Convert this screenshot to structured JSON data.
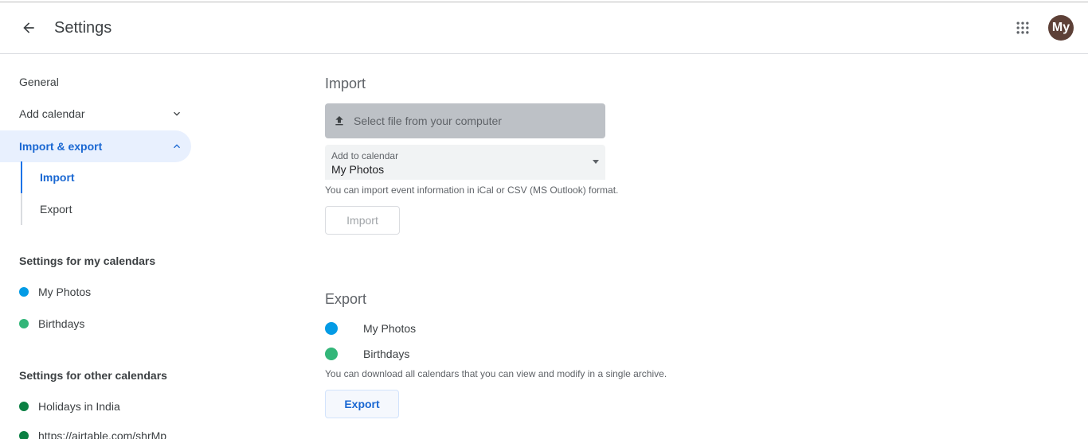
{
  "header": {
    "title": "Settings",
    "avatar_text": "My"
  },
  "sidebar": {
    "general": "General",
    "add_calendar": "Add calendar",
    "import_export": "Import & export",
    "sub_items": [
      "Import",
      "Export"
    ],
    "my_calendars_heading": "Settings for my calendars",
    "my_calendars": [
      {
        "label": "My Photos",
        "color": "#039be5"
      },
      {
        "label": "Birthdays",
        "color": "#33b679"
      }
    ],
    "other_calendars_heading": "Settings for other calendars",
    "other_calendars": [
      {
        "label": "Holidays in India",
        "color": "#0b8043"
      },
      {
        "label": "https://airtable.com/shrMp",
        "color": "#0b8043"
      }
    ]
  },
  "import": {
    "title": "Import",
    "file_button": "Select file from your computer",
    "add_to_calendar_label": "Add to calendar",
    "add_to_calendar_value": "My Photos",
    "help": "You can import event information in iCal or CSV (MS Outlook) format.",
    "button": "Import"
  },
  "export": {
    "title": "Export",
    "calendars": [
      {
        "label": "My Photos",
        "color": "#039be5"
      },
      {
        "label": "Birthdays",
        "color": "#33b679"
      }
    ],
    "help": "You can download all calendars that you can view and modify in a single archive.",
    "button": "Export"
  },
  "colors": {
    "accent": "#1a73e8",
    "active_bg": "#e8f0fe",
    "avatar_bg": "#5d4037"
  }
}
